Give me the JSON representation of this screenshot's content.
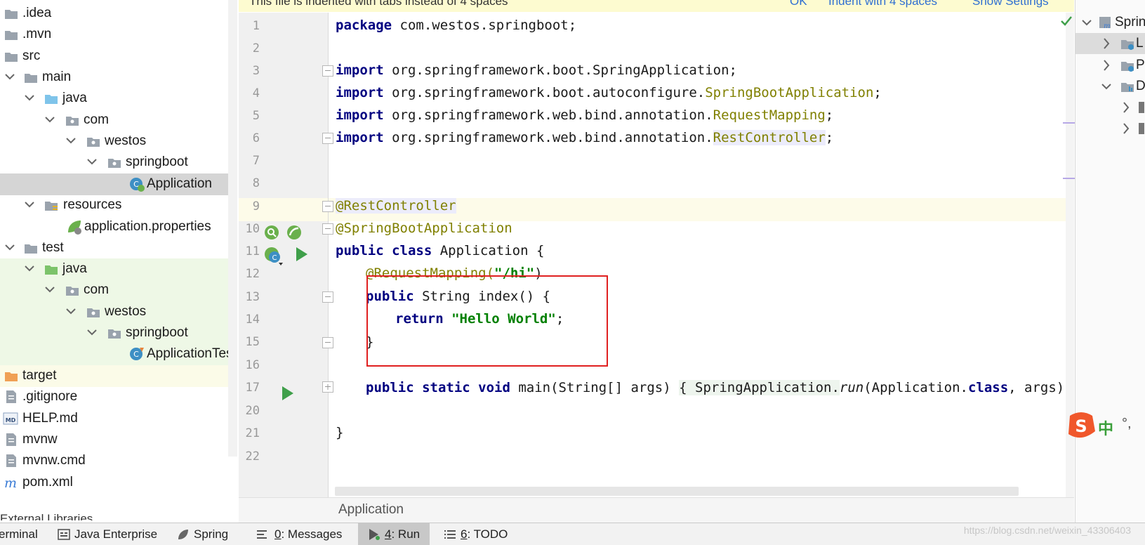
{
  "notification": {
    "message": "This file is indented with tabs instead of 4 spaces",
    "action_ok": "OK",
    "action_indent": "Indent with 4 spaces",
    "action_settings": "Show Settings"
  },
  "project_tree": [
    {
      "label": ".idea",
      "type": "folder"
    },
    {
      "label": ".mvn",
      "type": "folder"
    },
    {
      "label": "src",
      "type": "folder"
    },
    {
      "label": "main",
      "type": "folder"
    },
    {
      "label": "java",
      "type": "source-folder"
    },
    {
      "label": "com",
      "type": "package"
    },
    {
      "label": "westos",
      "type": "package"
    },
    {
      "label": "springboot",
      "type": "package"
    },
    {
      "label": "Application",
      "type": "spring-class"
    },
    {
      "label": "resources",
      "type": "resources-folder"
    },
    {
      "label": "application.properties",
      "type": "properties-file"
    },
    {
      "label": "test",
      "type": "folder"
    },
    {
      "label": "java",
      "type": "test-folder"
    },
    {
      "label": "com",
      "type": "package"
    },
    {
      "label": "westos",
      "type": "package"
    },
    {
      "label": "springboot",
      "type": "package"
    },
    {
      "label": "ApplicationTes",
      "type": "test-class"
    },
    {
      "label": "target",
      "type": "excluded-folder"
    },
    {
      "label": ".gitignore",
      "type": "file"
    },
    {
      "label": "HELP.md",
      "type": "md-file"
    },
    {
      "label": "mvnw",
      "type": "file"
    },
    {
      "label": "mvnw.cmd",
      "type": "file"
    },
    {
      "label": "pom.xml",
      "type": "maven-file"
    }
  ],
  "external_libraries": "External Libraries",
  "editor": {
    "line_numbers": [
      "1",
      "2",
      "3",
      "4",
      "5",
      "6",
      "7",
      "8",
      "9",
      "10",
      "11",
      "12",
      "13",
      "14",
      "15",
      "16",
      "17",
      "20",
      "21",
      "22"
    ],
    "code": {
      "l1_kw": "package",
      "l1_rest": " com.westos.springboot;",
      "import_kw": "import",
      "l3_path": " org.springframework.boot.SpringApplication;",
      "l4_path": " org.springframework.boot.autoconfigure.",
      "l4_cls": "SpringBootApplication",
      "l5_path": " org.springframework.web.bind.annotation.",
      "l5_cls": "RequestMapping",
      "l6_path": " org.springframework.web.bind.annotation.",
      "l6_cls": "RestController",
      "semicolon": ";",
      "l9_ann": "@RestController",
      "l10_ann": "@SpringBootApplication",
      "l11_kw": "public class",
      "l11_rest": " Application {",
      "l12_ann": "@RequestMapping(",
      "l12_str": "\"/hi\"",
      "l12_close": ")",
      "l13_kw": "public",
      "l13_rest": " String index() {",
      "l14_kw": "return",
      "l14_str": "\"Hello World\"",
      "l15": "}",
      "l17_kw": "public static void",
      "l17_a": " main(String[] args) ",
      "l17_b": "{ SpringApplication.",
      "l17_run": "run",
      "l17_c": "(Application.",
      "l17_class": "class",
      "l17_d": ", args); }",
      "l21": "}"
    },
    "breadcrumb": "Application"
  },
  "structure_panel": {
    "rows": [
      "Sprin",
      "L",
      "P",
      "D",
      "",
      ""
    ]
  },
  "tool_windows": [
    {
      "label": "erminal",
      "mnemonic": ""
    },
    {
      "label": "Java Enterprise",
      "mnemonic": ""
    },
    {
      "label": "Spring",
      "mnemonic": ""
    },
    {
      "label": ": Messages",
      "mnemonic": "0"
    },
    {
      "label": ": Run",
      "mnemonic": "4"
    },
    {
      "label": ": TODO",
      "mnemonic": "6"
    }
  ],
  "watermark": "https://blog.csdn.net/weixin_43306403",
  "ime": {
    "glyph": "中",
    "punct": "°,"
  },
  "colors": {
    "keyword": "#000080",
    "annotation": "#808000",
    "string": "#008000",
    "highlight_box": "#e02020"
  }
}
